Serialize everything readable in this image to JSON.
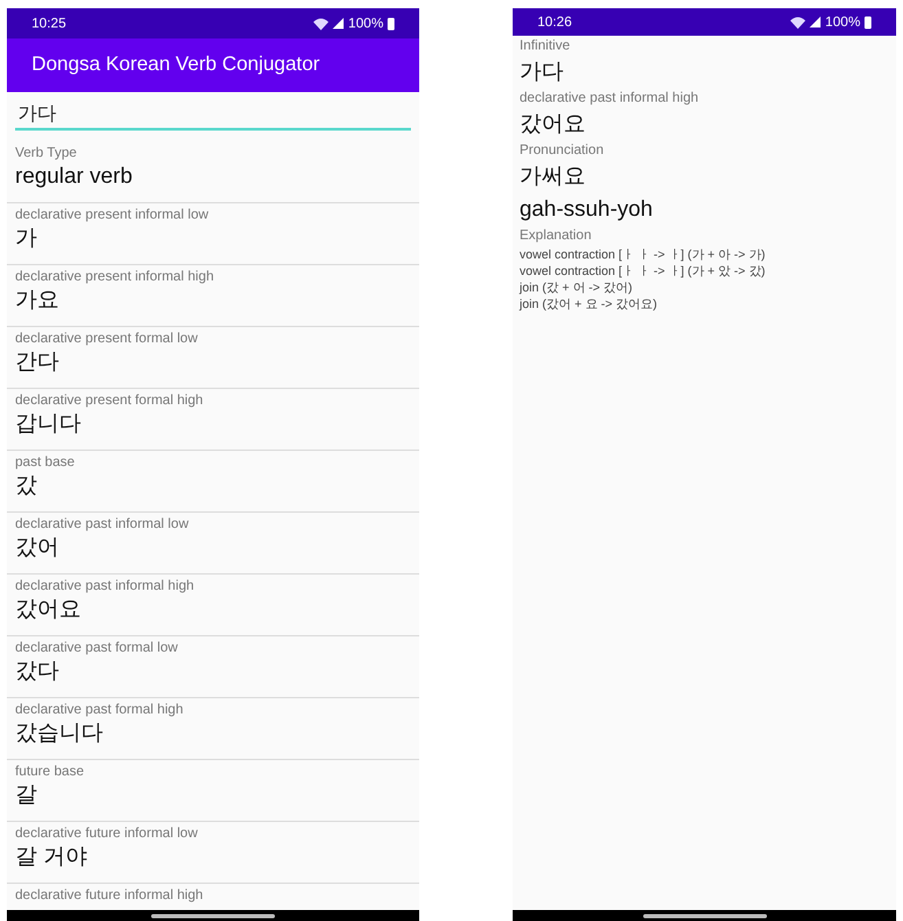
{
  "left_screen": {
    "status_bar": {
      "time": "10:25",
      "battery": "100%"
    },
    "app_bar": {
      "title": "Dongsa Korean Verb Conjugator"
    },
    "search": {
      "value": "가다"
    },
    "conjugations": [
      {
        "label": "Verb Type",
        "value": "regular verb"
      },
      {
        "label": "declarative present informal low",
        "value": "가"
      },
      {
        "label": "declarative present informal high",
        "value": "가요"
      },
      {
        "label": "declarative present formal low",
        "value": "간다"
      },
      {
        "label": "declarative present formal high",
        "value": "갑니다"
      },
      {
        "label": "past base",
        "value": "갔"
      },
      {
        "label": "declarative past informal low",
        "value": "갔어"
      },
      {
        "label": "declarative past informal high",
        "value": "갔어요"
      },
      {
        "label": "declarative past formal low",
        "value": "갔다"
      },
      {
        "label": "declarative past formal high",
        "value": "갔습니다"
      },
      {
        "label": "future base",
        "value": "갈"
      },
      {
        "label": "declarative future informal low",
        "value": "갈 거야"
      },
      {
        "label": "declarative future informal high"
      }
    ]
  },
  "right_screen": {
    "status_bar": {
      "time": "10:26",
      "battery": "100%"
    },
    "details": [
      {
        "label": "Infinitive",
        "values": [
          "가다"
        ]
      },
      {
        "label": "declarative past informal high",
        "values": [
          "갔어요"
        ]
      },
      {
        "label": "Pronunciation",
        "values": [
          "가써요",
          "gah-ssuh-yoh"
        ]
      }
    ],
    "explanation": {
      "label": "Explanation",
      "steps": [
        "vowel contraction [ㅏ ㅏ -> ㅏ] (가 + 아 -> 가)",
        "vowel contraction [ㅏ ㅏ -> ㅏ] (가 + 았 -> 갔)",
        "join (갔 + 어 -> 갔어)",
        "join (갔어 + 요 -> 갔어요)"
      ]
    }
  }
}
